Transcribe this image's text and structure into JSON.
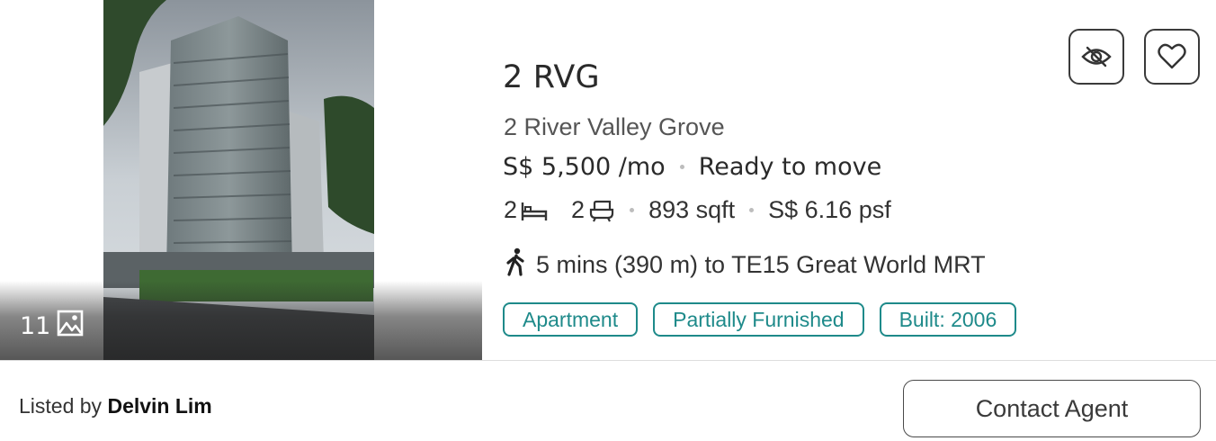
{
  "listing": {
    "photo_count": "11",
    "title": "2 RVG",
    "address": "2 River Valley Grove",
    "price": "S$ 5,500 /mo",
    "availability": "Ready to move",
    "beds": "2",
    "baths": "2",
    "size": "893 sqft",
    "psf": "S$ 6.16 psf",
    "mrt": "5 mins (390 m) to TE15 Great World MRT",
    "tags": [
      "Apartment",
      "Partially Furnished",
      "Built: 2006"
    ]
  },
  "footer": {
    "listed_by_label": "Listed by",
    "agent_name": "Delvin Lim",
    "contact_label": "Contact Agent"
  },
  "icons": {
    "hide": "eye-slash-icon",
    "favorite": "heart-icon",
    "gallery": "image-icon",
    "bed": "bed-icon",
    "bath": "bathtub-icon",
    "walk": "walking-person-icon"
  },
  "colors": {
    "tag_accent": "#1e8a8a",
    "text_primary": "#2a2a2a"
  }
}
